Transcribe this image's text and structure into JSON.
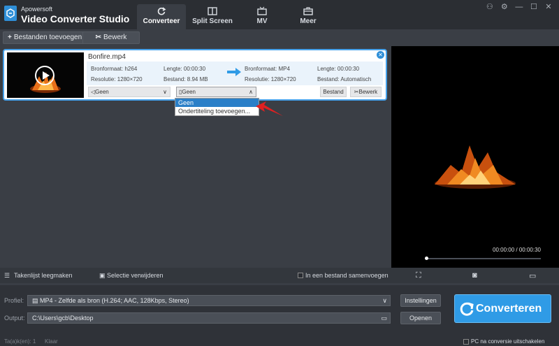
{
  "app": {
    "brand_small": "Apowersoft",
    "brand_title": "Video Converter Studio"
  },
  "nav_tabs": [
    {
      "label": "Converteer",
      "icon": "refresh-icon",
      "active": true
    },
    {
      "label": "Split Screen",
      "icon": "split-screen-icon"
    },
    {
      "label": "MV",
      "icon": "tv-icon"
    },
    {
      "label": "Meer",
      "icon": "toolbox-icon"
    }
  ],
  "window_controls": {
    "icons": [
      "user-icon",
      "settings-icon",
      "minimize-icon",
      "maximize-icon",
      "close-icon"
    ],
    "glyphs": [
      "⚇",
      "⚙",
      "—",
      "☐",
      "✕"
    ]
  },
  "toolbar": {
    "add_files": "Bestanden toevoegen",
    "edit": "Bewerk"
  },
  "task": {
    "filename": "Bonfire.mp4",
    "source_format_label": "Bronformaat: h264",
    "source_length": "Lengte: 00:00:30",
    "source_resolution": "Resolutie: 1280×720",
    "source_size": "Bestand: 8.94 MB",
    "target_format_label": "Bronformaat: MP4",
    "target_length": "Lengte: 00:00:30",
    "target_resolution": "Resolutie: 1280×720",
    "target_size": "Bestand: Automatisch",
    "audio_select": "Geen",
    "subtitle_select": "Geen",
    "file_button": "Bestand",
    "edit_button": "Bewerk"
  },
  "subtitle_dropdown": {
    "options": [
      "Geen",
      "Ondertiteling toevoegen..."
    ],
    "selected_index": 0
  },
  "preview": {
    "timecode": "00:00:00 / 00:00:30",
    "progress": 0.0
  },
  "bottom_tools": {
    "clear_list": "Takenlijst leegmaken",
    "remove_selection": "Selectie verwijderen",
    "merge_into_one": "In een bestand samenvoegen"
  },
  "settings": {
    "profile_label": "Profiel:",
    "profile_value": "MP4 - Zelfde als bron (H.264; AAC, 128Kbps, Stereo)",
    "output_label": "Output:",
    "output_value": "C:\\Users\\gcb\\Desktop",
    "settings_button": "Instellingen",
    "open_button": "Openen",
    "convert_button": "Converteren"
  },
  "status": {
    "tasks": "Ta(a)k(en): 1",
    "state": "Klaar",
    "shutdown_option": "PC na conversie uitschakelen"
  },
  "colors": {
    "accent": "#2f9be6",
    "card_border": "#46a1ea",
    "red_arrow": "#e02020"
  }
}
